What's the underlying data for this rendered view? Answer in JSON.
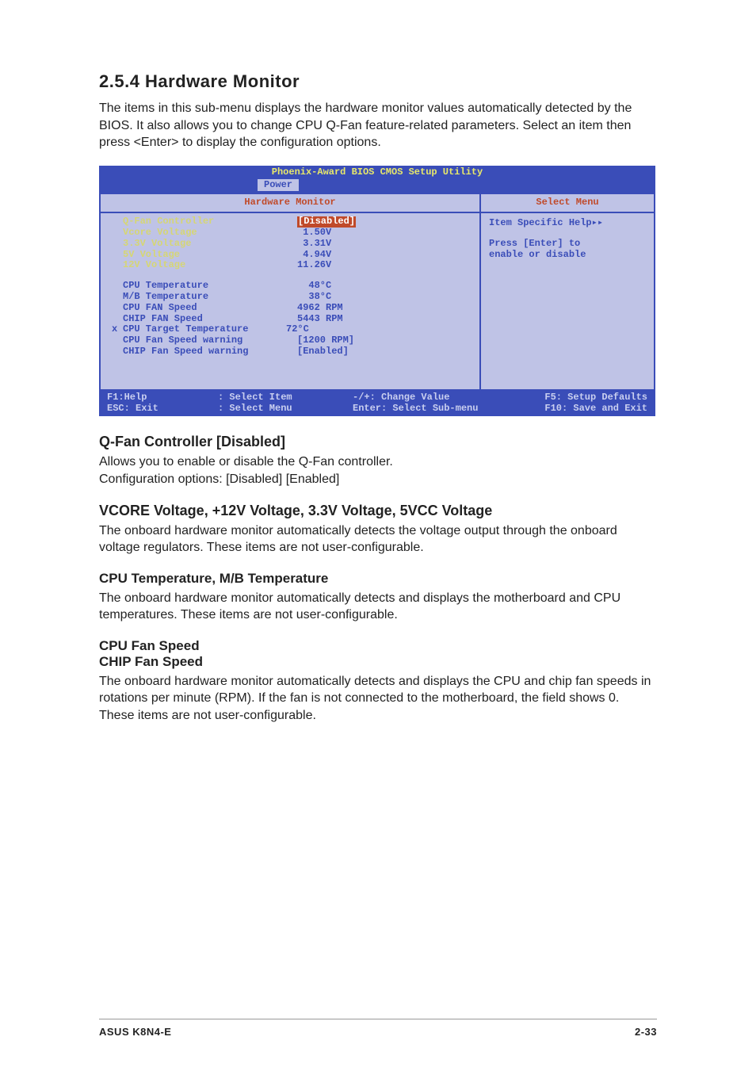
{
  "section": {
    "number_title": "2.5.4   Hardware Monitor",
    "intro": "The items in this sub-menu displays the hardware monitor values automatically detected by the BIOS. It also allows you to change CPU Q-Fan feature-related parameters. Select an item then press <Enter> to display the configuration options."
  },
  "bios": {
    "title": "Phoenix-Award BIOS CMOS Setup Utility",
    "tab": "Power",
    "left_header": "Hardware Monitor",
    "right_header": "Select Menu",
    "rows_group1": [
      {
        "label": "Q-Fan Controller",
        "value": "[Disabled]",
        "selected": true
      },
      {
        "label": "Vcore Voltage",
        "value": " 1.50V"
      },
      {
        "label": "3.3V Voltage",
        "value": " 3.31V"
      },
      {
        "label": "5V Voltage",
        "value": " 4.94V"
      },
      {
        "label": "12V Voltage",
        "value": "11.26V"
      }
    ],
    "rows_group2": [
      {
        "label": "CPU Temperature",
        "value": "  48°C"
      },
      {
        "label": "M/B Temperature",
        "value": "  38°C"
      },
      {
        "label": "CPU FAN Speed",
        "value": "4962 RPM"
      },
      {
        "label": "CHIP FAN Speed",
        "value": "5443 RPM"
      },
      {
        "label": "CPU Target Temperature",
        "value": "72°C",
        "x": true
      },
      {
        "label": "CPU Fan Speed warning",
        "value": "[1200 RPM]"
      },
      {
        "label": "CHIP Fan Speed warning",
        "value": "[Enabled]"
      }
    ],
    "help": {
      "top": "Item Specific Help",
      "line1": "Press [Enter] to",
      "line2": "enable or disable"
    },
    "footer": {
      "r1c1": "F1:Help",
      "r1c2": ": Select Item",
      "r1c3": "-/+: Change Value",
      "r1c4": "F5: Setup Defaults",
      "r2c1": "ESC: Exit",
      "r2c2": ": Select Menu",
      "r2c3": "Enter: Select Sub-menu",
      "r2c4": "F10: Save and Exit"
    }
  },
  "subsections": {
    "qfan_title": "Q-Fan Controller [Disabled]",
    "qfan_p1": "Allows you to enable or disable the Q-Fan controller.",
    "qfan_p2": "Configuration options: [Disabled] [Enabled]",
    "vcore_title": "VCORE Voltage, +12V Voltage, 3.3V Voltage, 5VCC Voltage",
    "vcore_p": "The onboard hardware monitor automatically detects the voltage output through the onboard voltage regulators. These items are not user-configurable.",
    "temp_title": "CPU Temperature, M/B Temperature",
    "temp_p": "The onboard hardware monitor automatically detects and displays the motherboard and CPU temperatures. These items are not user-configurable.",
    "fan_title1": "CPU Fan Speed",
    "fan_title2": "CHIP Fan Speed",
    "fan_p": "The onboard hardware monitor automatically detects and displays the CPU and chip fan speeds in rotations per minute (RPM). If the fan is not connected to the motherboard, the field shows 0. These items are not user-configurable."
  },
  "footer": {
    "left": "ASUS K8N4-E",
    "right": "2-33"
  }
}
